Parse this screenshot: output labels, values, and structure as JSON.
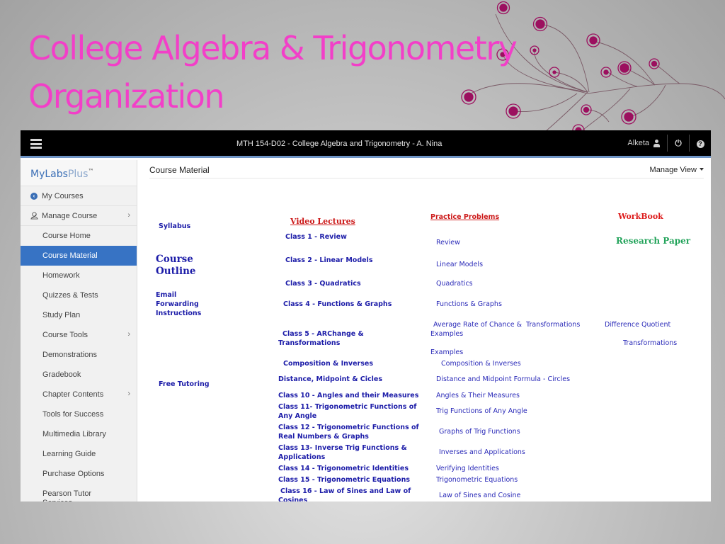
{
  "slide": {
    "title_line1": "College Algebra & Trigonometry",
    "title_line2": "Organization",
    "title_color": "#f23fc8",
    "decor_color": "#9c0f5f"
  },
  "topbar": {
    "course_title": "MTH 154-D02 - College Algebra and Trigonometry - A. Nina",
    "user_name": "Alketa",
    "power_icon": "⏻",
    "help_icon": "?"
  },
  "sidebar": {
    "brand_main": "MyLabs",
    "brand_plus": "Plus",
    "brand_tm": "™",
    "top_items": [
      {
        "label": "My Courses",
        "icon": "back-circle-icon"
      },
      {
        "label": "Manage Course",
        "icon": "manage-icon",
        "chevron": "›"
      }
    ],
    "items": [
      {
        "label": "Course Home"
      },
      {
        "label": "Course Material",
        "active": true
      },
      {
        "label": "Homework"
      },
      {
        "label": "Quizzes & Tests"
      },
      {
        "label": "Study Plan"
      },
      {
        "label": "Course Tools",
        "chevron": "›"
      },
      {
        "label": "Demonstrations"
      },
      {
        "label": "Gradebook"
      },
      {
        "label": "Chapter Contents",
        "chevron": "›"
      },
      {
        "label": "Tools for Success"
      },
      {
        "label": "Multimedia Library"
      },
      {
        "label": "Learning Guide"
      },
      {
        "label": "Purchase Options"
      },
      {
        "label": "Pearson Tutor Services"
      }
    ],
    "active_color": "#3773c4"
  },
  "main": {
    "title": "Course Material",
    "manage_view": "Manage View",
    "col1": {
      "syllabus": "Syllabus",
      "course_outline_1": "Course",
      "course_outline_2": "Outline",
      "email_1": "Email",
      "email_2": "Forwarding",
      "email_3": "Instructions",
      "free_tutoring": "Free Tutoring"
    },
    "video_lectures": {
      "heading": "Video Lectures",
      "items": [
        "Class 1 - Review",
        "Class 2 - Linear Models",
        "Class 3 - Quadratics",
        "Class 4 - Functions & Graphs",
        "Class 5 - ARChange &",
        "Transformations",
        "Composition & Inverses",
        "Distance, Midpoint & Cicles",
        "Class 10 - Angles and their Measures",
        "Class 11- Trigonometric Functions of",
        "Any Angle",
        "Class 12 - Trigonometric Functions of",
        "Real Numbers & Graphs",
        "Class 13- Inverse Trig Functions &",
        "Applications",
        "Class 14 - Trigonometric Identities",
        "Class 15 - Trigonometric Equations",
        "Class 16 - Law of Sines and Law of",
        "Cosines"
      ]
    },
    "practice_problems": {
      "heading": "Practice Problems",
      "items": [
        "Review",
        "Linear Models",
        "Quadratics",
        "Functions & Graphs",
        "Average Rate of Chance &  Transformations",
        "Examples",
        "Examples",
        "Composition & Inverses",
        "Distance and Midpoint Formula - Circles",
        "Angles & Their Measures",
        "Trig Functions of Any Angle",
        "Graphs of Trig Functions",
        "Inverses and Applications",
        "Verifying Identities",
        "Trigonometric Equations",
        "Law of Sines and Cosine"
      ]
    },
    "col4": {
      "workbook": "WorkBook",
      "research_paper": "Research Paper",
      "difference_quotient": "Difference Quotient",
      "transformations": "Transformations"
    }
  }
}
